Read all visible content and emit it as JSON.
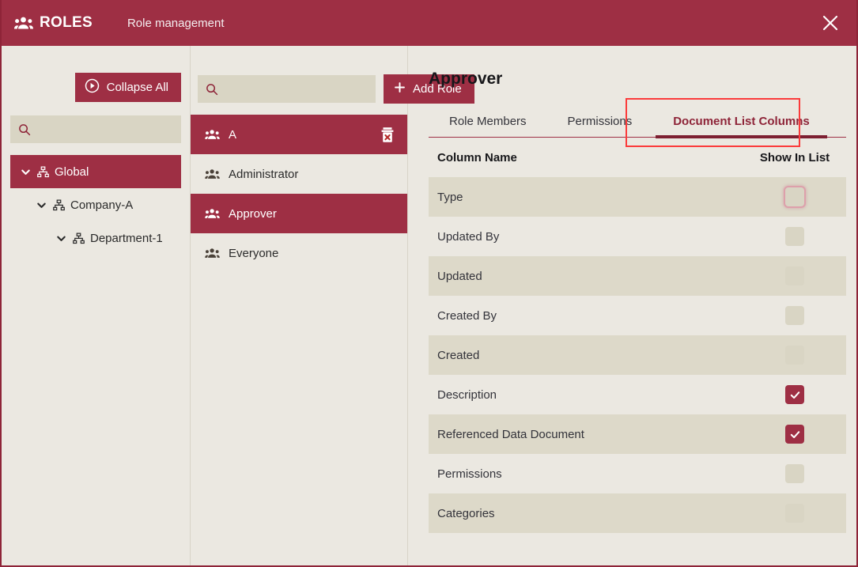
{
  "titlebar": {
    "brand": "ROLES",
    "brand_icon": "people-icon",
    "subtitle": "Role management",
    "close_icon": "close-icon",
    "bg_color": "#9e2f44"
  },
  "tree_panel": {
    "collapse_button": {
      "label": "Collapse All",
      "icon": "collapse-circle-icon"
    },
    "search": {
      "value": "",
      "placeholder": "",
      "icon": "search-icon"
    },
    "nodes": [
      {
        "label": "Global",
        "icon": "sitemap-icon",
        "chevron": "chevron-down-icon",
        "level": 0,
        "selected": true
      },
      {
        "label": "Company-A",
        "icon": "sitemap-icon",
        "chevron": "chevron-down-icon",
        "level": 1,
        "selected": false
      },
      {
        "label": "Department-1",
        "icon": "sitemap-icon",
        "chevron": "chevron-down-icon",
        "level": 2,
        "selected": false
      }
    ]
  },
  "roles_panel": {
    "search": {
      "value": "",
      "placeholder": "",
      "icon": "search-icon"
    },
    "add_button": {
      "label": "Add Role",
      "icon": "plus-icon"
    },
    "roles": [
      {
        "label": "A",
        "icon": "people-icon",
        "selected": true,
        "has_delete": true,
        "delete_icon": "trash-delete-icon"
      },
      {
        "label": "Administrator",
        "icon": "people-icon",
        "selected": false,
        "has_delete": false
      },
      {
        "label": "Approver",
        "icon": "people-icon",
        "selected": true,
        "has_delete": false
      },
      {
        "label": "Everyone",
        "icon": "people-icon",
        "selected": false,
        "has_delete": false
      }
    ]
  },
  "detail_panel": {
    "title": "Approver",
    "tabs": [
      {
        "label": "Role Members",
        "active": false
      },
      {
        "label": "Permissions",
        "active": false
      },
      {
        "label": "Document List Columns",
        "active": true,
        "highlighted": true
      }
    ],
    "highlight_color": "#fb3b3b",
    "table": {
      "headers": {
        "column_name": "Column Name",
        "show_in_list": "Show In List"
      },
      "rows": [
        {
          "name": "Type",
          "checked": false,
          "hover": true
        },
        {
          "name": "Updated By",
          "checked": false,
          "hover": false
        },
        {
          "name": "Updated",
          "checked": false,
          "hover": false
        },
        {
          "name": "Created By",
          "checked": false,
          "hover": false
        },
        {
          "name": "Created",
          "checked": false,
          "hover": false
        },
        {
          "name": "Description",
          "checked": true,
          "hover": false
        },
        {
          "name": "Referenced Data Document",
          "checked": true,
          "hover": false
        },
        {
          "name": "Permissions",
          "checked": false,
          "hover": false
        },
        {
          "name": "Categories",
          "checked": false,
          "hover": false
        }
      ]
    }
  }
}
